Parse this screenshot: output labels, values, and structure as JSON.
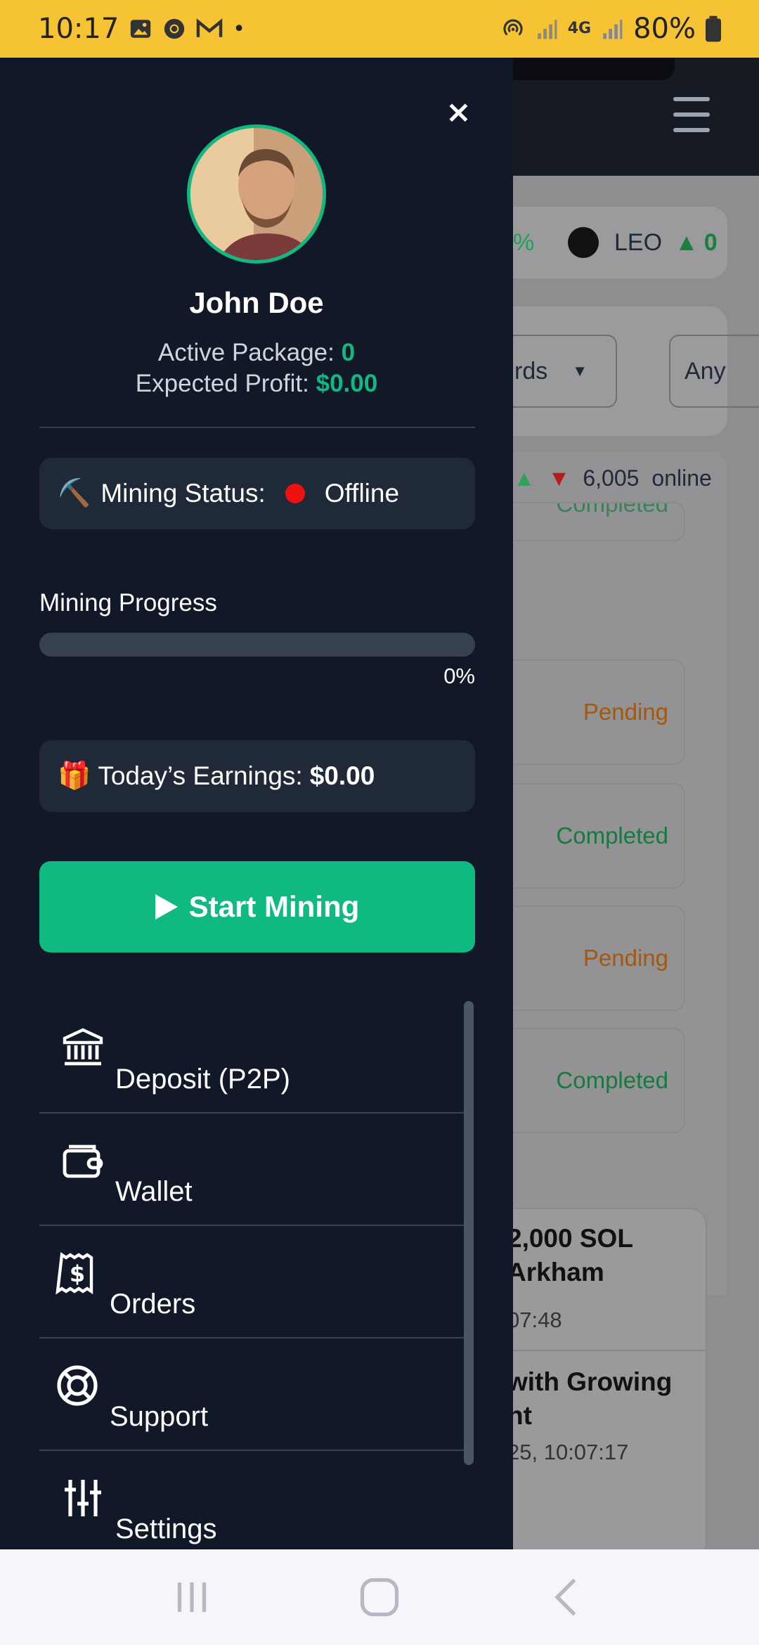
{
  "status_bar": {
    "time": "10:17",
    "dot": "•",
    "network": "4G",
    "battery": "80%"
  },
  "background": {
    "ticker_fragment": "%",
    "ticker_symbol": "LEO",
    "ticker_change": "0",
    "filter_select_1": "rds",
    "filter_select_2": "Any",
    "online_count": "6,005",
    "online_label": "online",
    "order_statuses": [
      "Completed",
      "Pending",
      "Completed",
      "Pending",
      "Completed"
    ],
    "news": [
      {
        "title": "2,000 SOL Arkham",
        "time": "07:48"
      },
      {
        "title": "with Growing nt",
        "time": "25, 10:07:17"
      }
    ]
  },
  "drawer": {
    "close_label": "×",
    "user_name": "John Doe",
    "active_package_label": "Active Package:",
    "active_package_value": "0",
    "expected_profit_label": "Expected Profit:",
    "expected_profit_value": "$0.00",
    "mining_status_label": "Mining Status:",
    "mining_status_value": "Offline",
    "mining_progress_label": "Mining Progress",
    "mining_progress_percent": 0,
    "mining_progress_text": "0%",
    "todays_earnings_label": "Today’s Earnings:",
    "todays_earnings_value": "$0.00",
    "start_button_label": "Start Mining",
    "menu": [
      {
        "label": "Deposit (P2P)",
        "icon": "bank-icon"
      },
      {
        "label": "Wallet",
        "icon": "wallet-icon"
      },
      {
        "label": "Orders",
        "icon": "receipt-dollar-icon"
      },
      {
        "label": "Support",
        "icon": "lifebuoy-icon"
      },
      {
        "label": "Settings",
        "icon": "sliders-icon"
      }
    ]
  },
  "colors": {
    "accent": "#10b981",
    "drawer_bg": "#111827",
    "status_bar": "#f6c334",
    "offline": "#ef1010"
  }
}
